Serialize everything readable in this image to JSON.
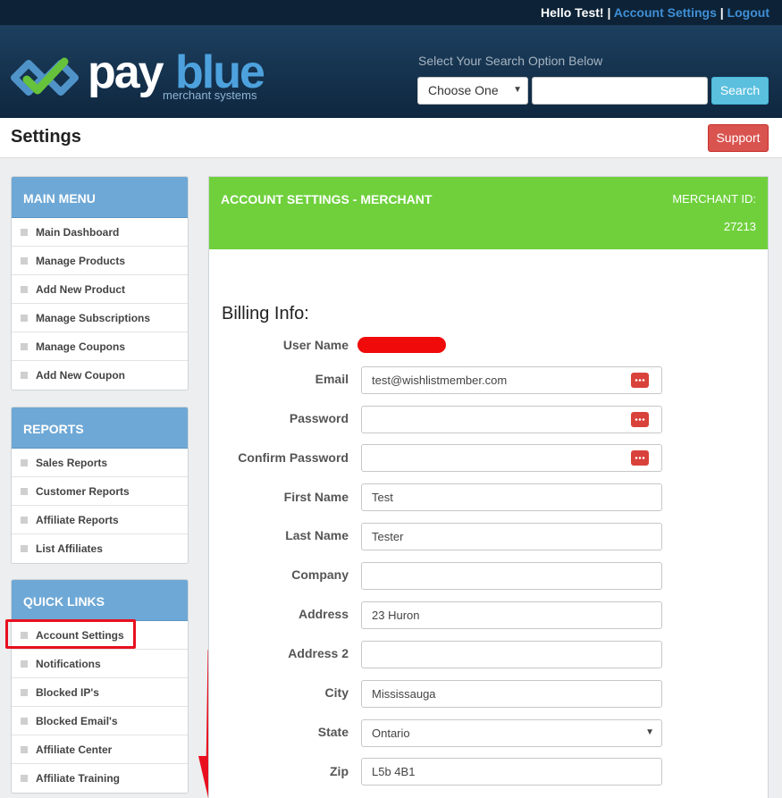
{
  "topbar": {
    "greeting": "Hello Test!",
    "separator": "|",
    "account_settings": "Account Settings",
    "logout": "Logout"
  },
  "header": {
    "logo_pay": "pay",
    "logo_blue": "blue",
    "logo_sub": "merchant systems",
    "search_hint": "Select Your Search Option Below",
    "search_select": "Choose One",
    "search_input": "",
    "search_button": "Search"
  },
  "settings_bar": {
    "title": "Settings",
    "support": "Support"
  },
  "sidebar": {
    "main_menu": {
      "title": "MAIN MENU",
      "items": [
        "Main Dashboard",
        "Manage Products",
        "Add New Product",
        "Manage Subscriptions",
        "Manage Coupons",
        "Add New Coupon"
      ]
    },
    "reports": {
      "title": "REPORTS",
      "items": [
        "Sales Reports",
        "Customer Reports",
        "Affiliate Reports",
        "List Affiliates"
      ]
    },
    "quick_links": {
      "title": "QUICK LINKS",
      "items": [
        "Account Settings",
        "Notifications",
        "Blocked IP's",
        "Blocked Email's",
        "Affiliate Center",
        "Affiliate Training"
      ]
    }
  },
  "main": {
    "title": "ACCOUNT SETTINGS - MERCHANT",
    "merchant_label": "MERCHANT ID:",
    "merchant_id": "27213",
    "billing_title": "Billing Info:",
    "fields": {
      "user_name": {
        "label": "User Name"
      },
      "email": {
        "label": "Email",
        "value": "test@wishlistmember.com"
      },
      "password": {
        "label": "Password",
        "value": ""
      },
      "confirm_password": {
        "label": "Confirm Password",
        "value": ""
      },
      "first_name": {
        "label": "First Name",
        "value": "Test"
      },
      "last_name": {
        "label": "Last Name",
        "value": "Tester"
      },
      "company": {
        "label": "Company",
        "value": ""
      },
      "address": {
        "label": "Address",
        "value": "23 Huron"
      },
      "address2": {
        "label": "Address 2",
        "value": ""
      },
      "city": {
        "label": "City",
        "value": "Mississauga"
      },
      "state": {
        "label": "State",
        "value": "Ontario"
      },
      "zip": {
        "label": "Zip",
        "value": "L5b 4B1"
      }
    }
  },
  "colors": {
    "accent_blue": "#6ea8d6",
    "header_green": "#6fd03c",
    "support_red": "#d9534f",
    "search_blue": "#5bc0de",
    "annotation_red": "#e8101f"
  },
  "icons": [
    "payblue-logo-icon",
    "password-manager-icon",
    "chevron-down-icon",
    "square-bullet-icon",
    "red-arrow-annotation"
  ]
}
